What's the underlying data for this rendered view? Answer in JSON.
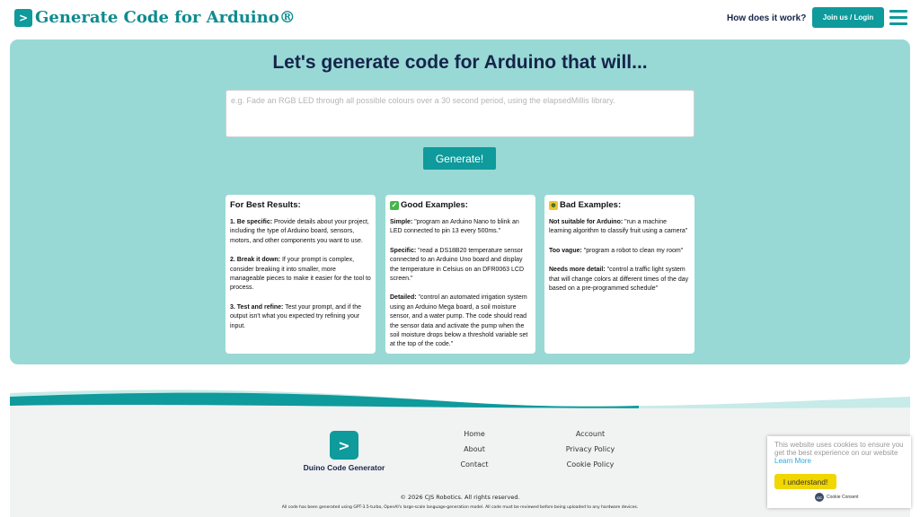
{
  "header": {
    "logo_glyph": ">",
    "title": "Generate Code for Arduino®",
    "how_link": "How does it work?",
    "join_label": "Join us / Login"
  },
  "hero": {
    "title": "Let's generate code for Arduino that will...",
    "placeholder": "e.g. Fade an RGB LED through all possible colours over a 30 second period, using the elapsedMillis library.",
    "generate_label": "Generate!"
  },
  "cards": {
    "best": {
      "title": "For Best Results:",
      "items": [
        {
          "label": "1. Be specific:",
          "text": " Provide details about your project, including the type of Arduino board, sensors, motors, and other components you want to use."
        },
        {
          "label": "2. Break it down:",
          "text": " If your prompt is complex, consider breaking it into smaller, more manageable pieces to make it easier for the tool to process."
        },
        {
          "label": "3. Test and refine:",
          "text": " Test your prompt, and if the output isn't what you expected try refining your input."
        }
      ]
    },
    "good": {
      "icon": "check-mark-icon",
      "title": "Good Examples:",
      "items": [
        {
          "label": "Simple:",
          "text": " \"program an Arduino Nano to blink an LED connected to pin 13 every 500ms.\""
        },
        {
          "label": "Specific:",
          "text": " \"read a DS18B20 temperature sensor connected to an Arduino Uno board and display the temperature in Celsius on an DFR0063 LCD screen.\""
        },
        {
          "label": "Detailed:",
          "text": " \"control an automated irrigation system using an Arduino Mega board, a soil moisture sensor, and a water pump. The code should read the sensor data and activate the pump when the soil moisture drops below a threshold variable set at the top of the code.\""
        }
      ]
    },
    "bad": {
      "icon": "robot-face-icon",
      "title": "Bad Examples:",
      "items": [
        {
          "label": "Not suitable for Arduino:",
          "text": " \"run a machine learning algorithm to classify fruit using a camera\""
        },
        {
          "label": "Too vague:",
          "text": " \"program a robot to clean my room\""
        },
        {
          "label": "Needs more detail:",
          "text": " \"control a traffic light system that will change colors at different times of the day based on a pre-programmed schedule\""
        }
      ]
    }
  },
  "footer": {
    "logo_glyph": ">",
    "brand": "Duino Code Generator",
    "links_col1": [
      "Home",
      "About",
      "Contact"
    ],
    "links_col2": [
      "Account",
      "Privacy Policy",
      "Cookie Policy"
    ],
    "copyright": "© 2026 CJS Robotics. All rights reserved.",
    "disclaimer": "All code has been generated using GPT-3.5-turbo, OpenAI's large-scale language-generation model. All code must be reviewed before being uploaded to any hardware devices."
  },
  "cookie": {
    "text": "This website uses cookies to ensure you get the best experience on our website ",
    "learn_more": "Learn More",
    "button": "I understand!",
    "consent_logo": "CC",
    "consent_label": "Cookie Consent"
  },
  "colors": {
    "brand": "#0f9a9c",
    "hero_bg": "#98d9d5",
    "navy": "#16244a",
    "cookie_button": "#f1d600"
  }
}
